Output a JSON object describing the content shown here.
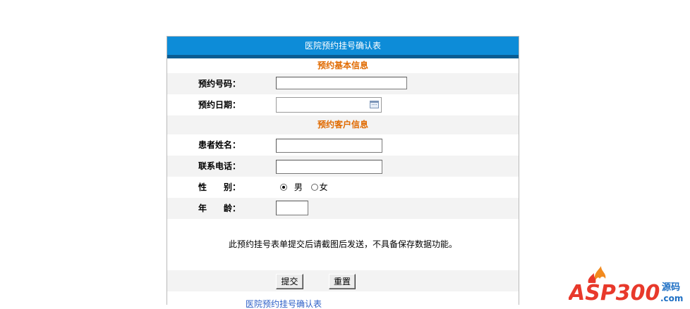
{
  "form": {
    "title": "医院预约挂号确认表",
    "section_basic": "预约基本信息",
    "section_customer": "预约客户信息",
    "fields": {
      "appointment_number": {
        "label": "预约号码：",
        "value": ""
      },
      "appointment_date": {
        "label": "预约日期：",
        "value": ""
      },
      "patient_name": {
        "label": "患者姓名：",
        "value": ""
      },
      "phone": {
        "label": "联系电话：",
        "value": ""
      },
      "gender": {
        "label": "性　　别：",
        "options": [
          "男",
          "女"
        ],
        "selected": "男"
      },
      "age": {
        "label": "年　　龄：",
        "value": ""
      }
    },
    "notice": "此预约挂号表单提交后请截图后发送，不具备保存数据功能。",
    "submit_label": "提交",
    "reset_label": "重置"
  },
  "footer": {
    "link_text": "医院预约挂号确认表"
  },
  "logo": {
    "text_main": "ASP300",
    "text_side": "源码",
    "text_domain": ".com",
    "colors": {
      "main": "#e8392b",
      "flame": "#f28a1e",
      "side": "#1d6fc4"
    }
  }
}
